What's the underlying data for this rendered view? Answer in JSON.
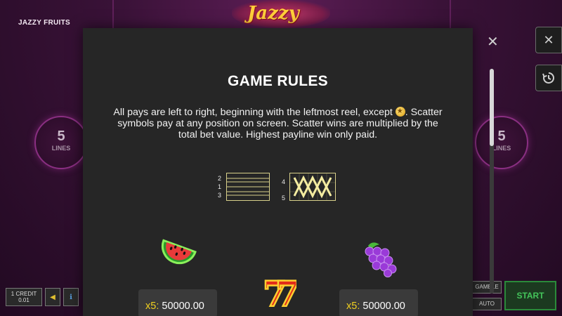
{
  "game": {
    "title": "JAZZY FRUITS",
    "logo_text": "Jazzy"
  },
  "lines": {
    "count": "5",
    "label": "LINES"
  },
  "controls": {
    "credit_line1": "1 CREDIT",
    "credit_line2": "0.01",
    "gamble_label": "GAMBLE",
    "auto_label": "AUTO",
    "start_label": "START",
    "close_icon": "close-icon",
    "history_icon": "history-icon"
  },
  "rules_panel": {
    "title": "GAME RULES",
    "text_before_icon": "All pays are left to right, beginning with the leftmost reel, except ",
    "text_after_icon": ". Scatter symbols pay at any position on screen. Scatter wins are multiplied by the total bet value. Highest payline win only paid.",
    "scatter_icon": "scatter-star-icon",
    "paylines_left_numbers": [
      "2",
      "1",
      "3"
    ],
    "paylines_right_numbers": [
      "4",
      "5"
    ],
    "paytable": [
      {
        "symbol": "watermelon-icon",
        "multiplier": "x5:",
        "amount": "50000.00"
      },
      {
        "symbol": "seven-icon"
      },
      {
        "symbol": "grapes-icon",
        "multiplier": "x5:",
        "amount": "50000.00"
      }
    ]
  },
  "colors": {
    "panel_bg": "#262626",
    "multiplier": "#f0d020",
    "start_green": "#43c45a",
    "payline": "#d8d08a"
  }
}
